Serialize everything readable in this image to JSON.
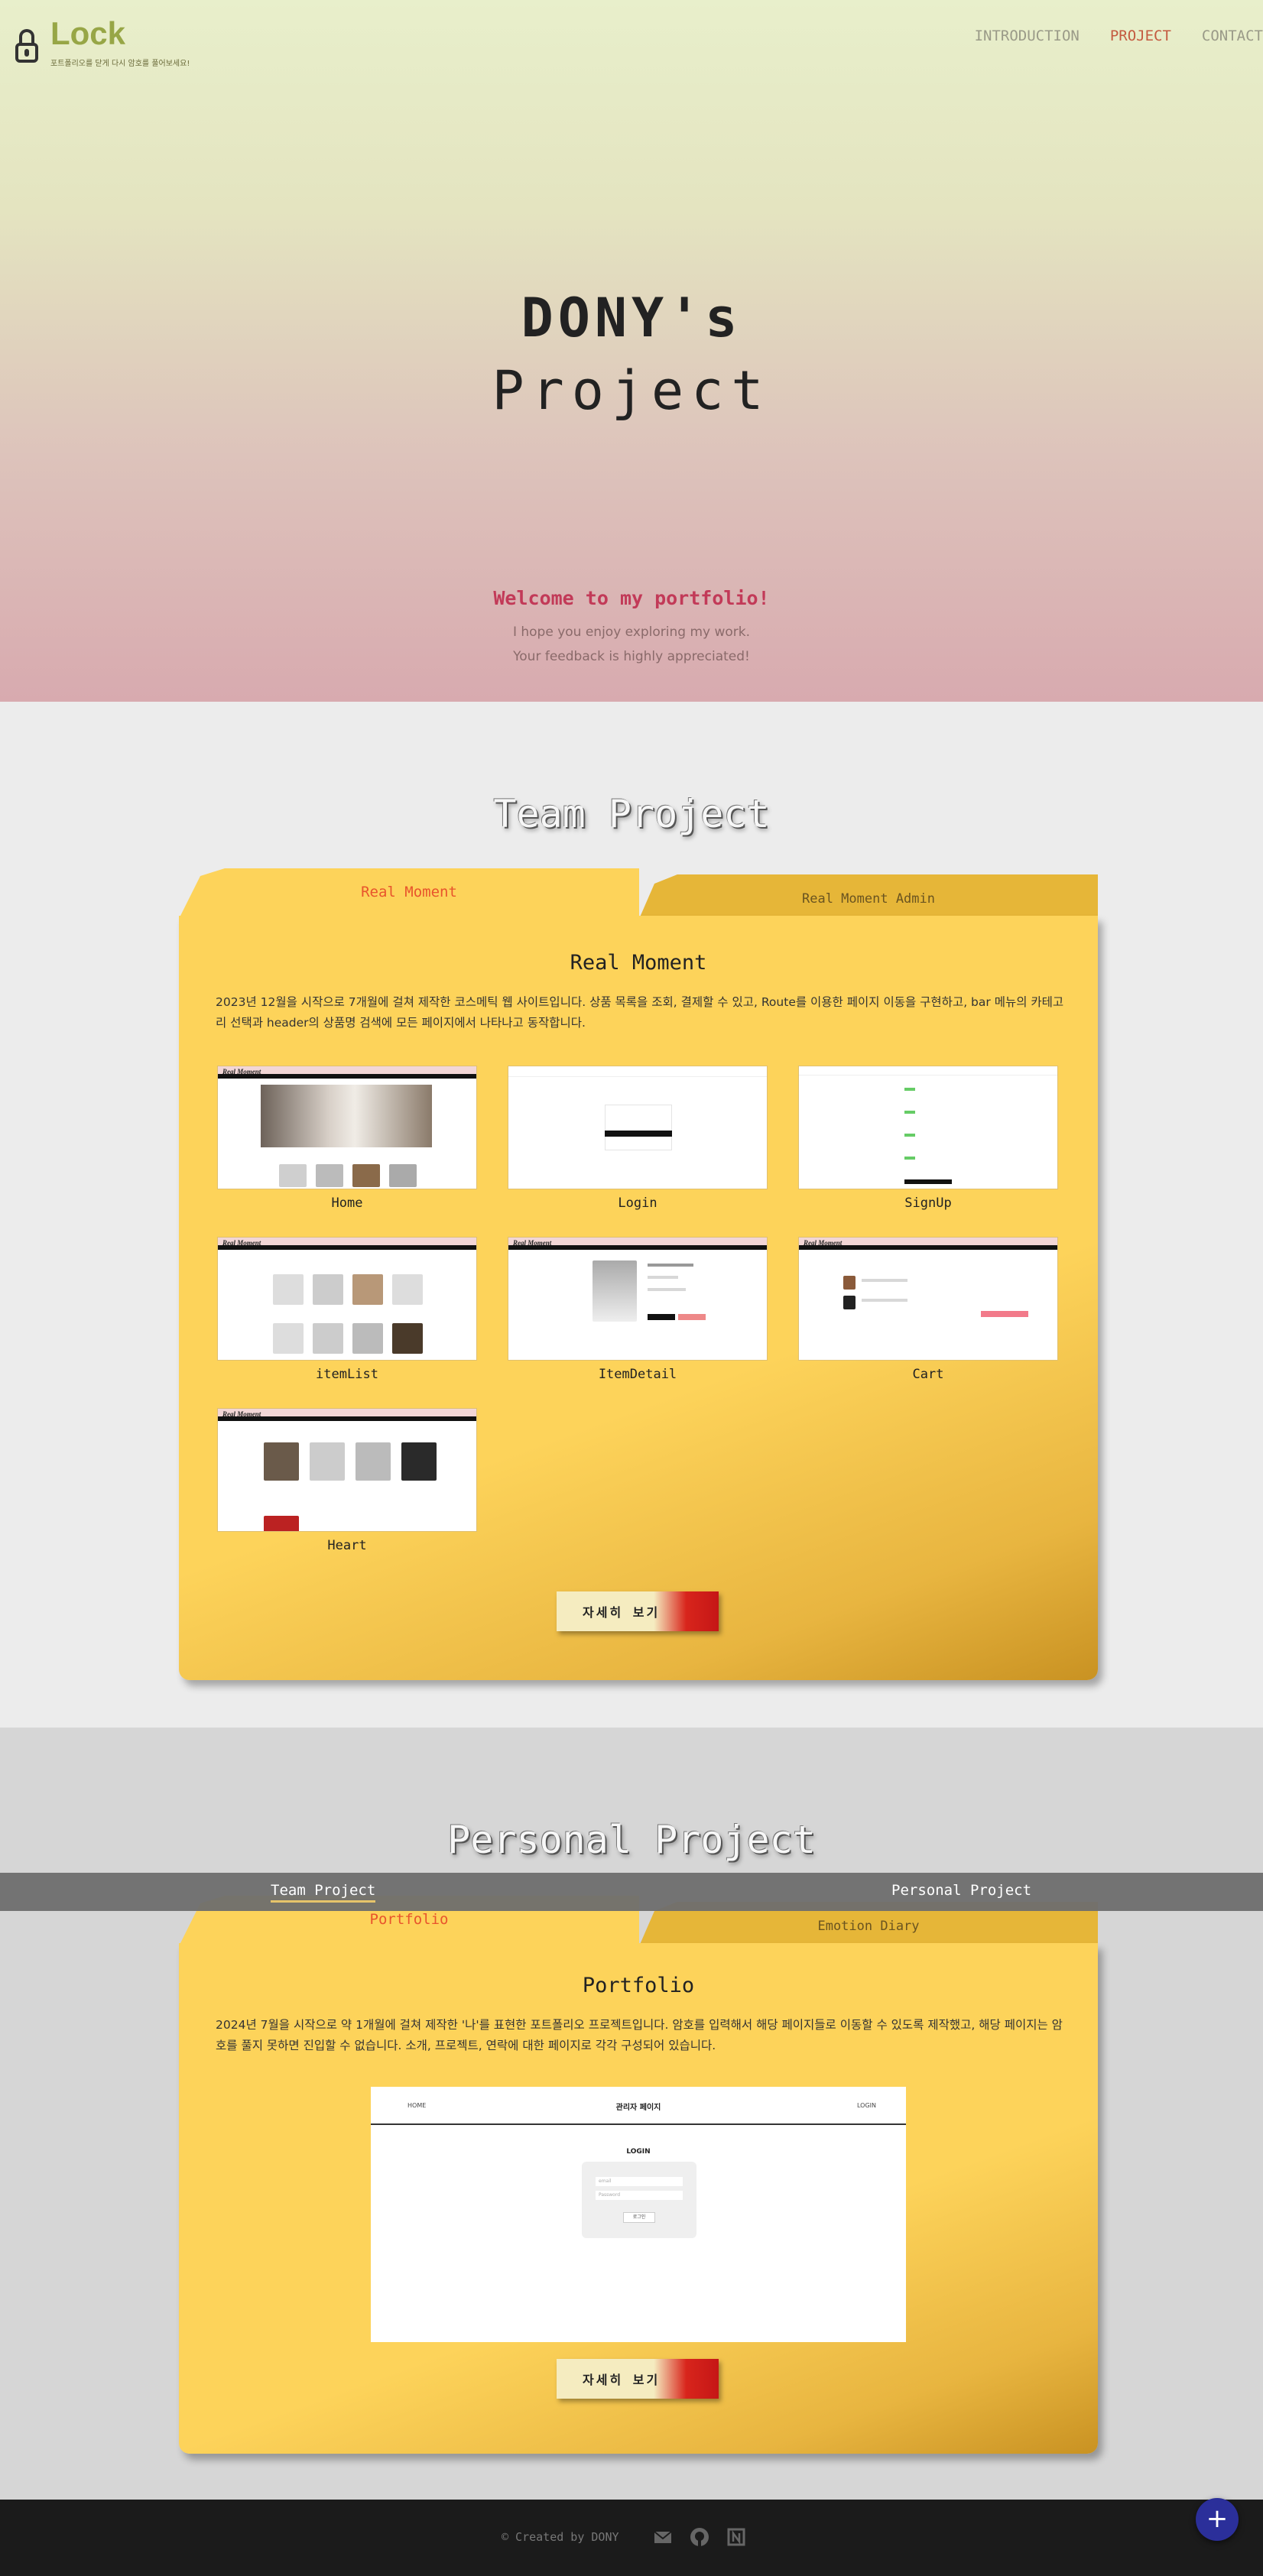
{
  "header": {
    "logo_title": "Lock",
    "logo_subtitle": "포트폴리오를 닫게 다시 암호를 풀어보세요!",
    "nav": [
      "INTRODUCTION",
      "PROJECT",
      "CONTACT"
    ],
    "active_nav": "PROJECT"
  },
  "hero": {
    "title_line1": "DONY's",
    "title_line2": "Project",
    "welcome": "Welcome to my portfolio!",
    "line1": "I hope you enjoy exploring my work.",
    "line2": "Your feedback is highly appreciated!"
  },
  "team": {
    "section_title": "Team Project",
    "tab_active": "Real Moment",
    "tab_inactive": "Real Moment Admin",
    "card_title": "Real Moment",
    "description": "2023년 12월을 시작으로 7개월에 걸쳐 제작한 코스메틱 웹 사이트입니다. 상품 목록을 조회, 결제할 수 있고, Route를 이용한 페이지 이동을 구현하고, bar 메뉴의 카테고리 선택과 header의 상품명 검색에 모든 페이지에서 나타나고 동작합니다.",
    "screenshots": [
      "Home",
      "Login",
      "SignUp",
      "itemList",
      "ItemDetail",
      "Cart",
      "Heart"
    ],
    "mini_brand": "Real Moment",
    "more_button": "자세히 보기"
  },
  "personal": {
    "section_title": "Personal Project",
    "tab_active": "Portfolio",
    "tab_inactive": "Emotion Diary",
    "card_title": "Portfolio",
    "description": "2024년 7월을 시작으로 약 1개월에 걸쳐 제작한 '나'를 표현한 포트폴리오 프로젝트입니다. 암호를 입력해서 해당 페이지들로 이동할 수 있도록 제작했고, 해당 페이지는 암호를 풀지 못하면 진입할 수 없습니다. 소개, 프로젝트, 연락에 대한 페이지로 각각 구성되어 있습니다.",
    "preview": {
      "nav_left": "HOME",
      "nav_center": "관리자 페이지",
      "nav_right": "LOGIN",
      "login_title": "LOGIN",
      "field1": "email",
      "field2": "Password",
      "button": "로그인"
    },
    "more_button": "자세히 보기"
  },
  "tabbar": {
    "items": [
      "Team Project",
      "Personal Project"
    ],
    "active": "Team Project"
  },
  "footer": {
    "copyright": "© Created by DONY",
    "icons": [
      "mail-icon",
      "github-icon",
      "notion-icon"
    ]
  },
  "fab": {
    "label": "+"
  },
  "colors": {
    "accent_nav": "#c45a40",
    "logo": "#97a646",
    "folder": "#fdd35a",
    "fab": "#2b2f9a"
  }
}
